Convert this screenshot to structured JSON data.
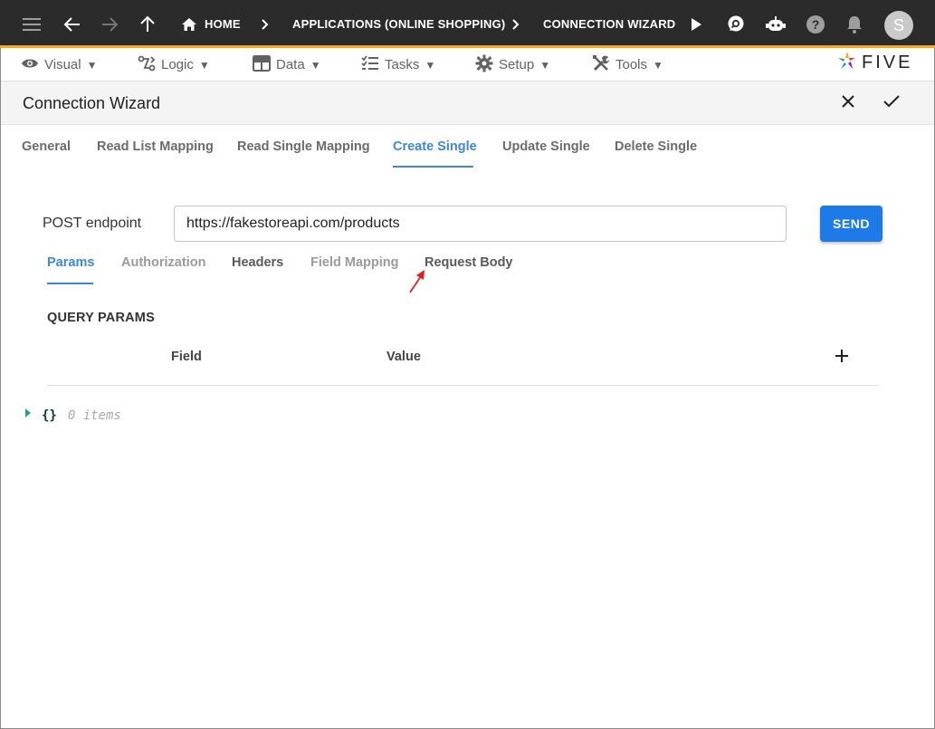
{
  "topbar": {
    "breadcrumbs": [
      "HOME",
      "APPLICATIONS (ONLINE SHOPPING)",
      "CONNECTION WIZARD"
    ],
    "avatar_initial": "S",
    "accent_color": "#f5a623"
  },
  "menubar": {
    "items": [
      {
        "label": "Visual",
        "caret": "▼",
        "icon": "eye-icon"
      },
      {
        "label": "Logic",
        "caret": "▼",
        "icon": "logic-icon"
      },
      {
        "label": "Data",
        "caret": "▼",
        "icon": "table-icon"
      },
      {
        "label": "Tasks",
        "caret": "▼",
        "icon": "tasks-icon"
      },
      {
        "label": "Setup",
        "caret": "▼",
        "icon": "gear-icon"
      },
      {
        "label": "Tools",
        "caret": "▼",
        "icon": "tools-icon"
      }
    ],
    "logo_text": "FIVE"
  },
  "page": {
    "title": "Connection Wizard"
  },
  "tabs": [
    {
      "label": "General"
    },
    {
      "label": "Read List Mapping"
    },
    {
      "label": "Read Single Mapping"
    },
    {
      "label": "Create Single",
      "active": true
    },
    {
      "label": "Update Single"
    },
    {
      "label": "Delete Single"
    }
  ],
  "endpoint": {
    "label": "POST endpoint",
    "value": "https://fakestoreapi.com/products",
    "send_label": "SEND"
  },
  "subtabs": [
    {
      "label": "Params",
      "active": true
    },
    {
      "label": "Authorization"
    },
    {
      "label": "Headers"
    },
    {
      "label": "Field Mapping"
    },
    {
      "label": "Request Body"
    }
  ],
  "query_params": {
    "title": "QUERY PARAMS",
    "columns": [
      "Field",
      "Value"
    ]
  },
  "json_viewer": {
    "braces": "{}",
    "count_text": "0 items"
  },
  "colors": {
    "primary": "#1e7ae6",
    "active_tab": "#3f86d6",
    "annotation_arrow": "#e02020"
  }
}
